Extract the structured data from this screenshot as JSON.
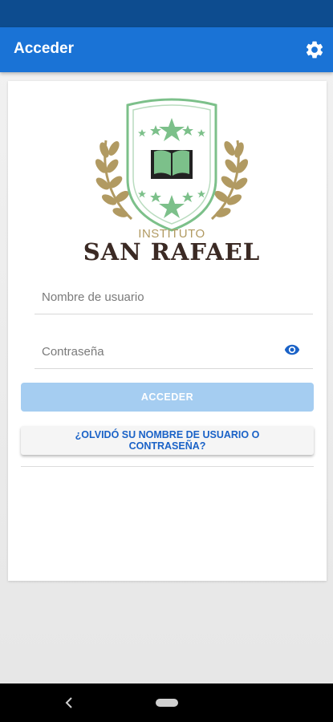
{
  "app_bar": {
    "title": "Acceder",
    "settings_icon": "gear-icon",
    "background": "#1a73d6"
  },
  "logo": {
    "line1": "INSTITUTO",
    "line2": "SAN RAFAEL",
    "colors": {
      "gold": "#b19a62",
      "green": "#7cc08a",
      "dark": "#3b2a24"
    }
  },
  "form": {
    "username_placeholder": "Nombre de usuario",
    "password_placeholder": "Contraseña",
    "visibility_icon": "eye-icon",
    "login_label": "ACCEDER",
    "forgot_label": "¿OLVIDÓ SU NOMBRE DE USUARIO O CONTRASEÑA?"
  },
  "nav": {
    "back_icon": "back-chevron-icon",
    "home_icon": "home-pill-icon"
  }
}
